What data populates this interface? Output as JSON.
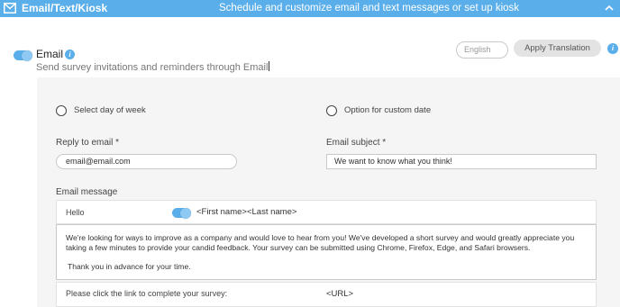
{
  "header": {
    "title": "Email/Text/Kiosk",
    "subtitle": "Schedule and customize email and text messages or set up kiosk"
  },
  "email_section": {
    "label": "Email",
    "description": "Send survey invitations and reminders through Email",
    "enabled": true
  },
  "translation": {
    "language_value": "English",
    "apply_label": "Apply Translation"
  },
  "schedule": {
    "option_day_of_week": "Select day of week",
    "option_custom_date": "Option for custom date"
  },
  "reply_to": {
    "label": "Reply to email *",
    "value": "email@email.com"
  },
  "subject": {
    "label": "Email subject *",
    "value": "We want to know what you think!"
  },
  "message": {
    "label": "Email message",
    "greeting": "Hello",
    "merge_fields": "<First name><Last name>",
    "body": "We're looking for ways to improve as a company and would love to hear from you! We've developed a short survey and would greatly appreciate you taking a few minutes to provide your candid feedback. Your survey can be submitted using Chrome, Firefox, Edge, and Safari browsers.",
    "thanks": "Thank you in advance for your time.",
    "link_prompt": "Please click the link to complete your survey:",
    "link_token": "<URL>"
  },
  "colors": {
    "accent": "#5aaeea",
    "panel_bg": "#f5f5f5"
  },
  "icons": {
    "header": "envelope-icon",
    "collapse": "chevron-up-icon",
    "info": "info-icon"
  }
}
